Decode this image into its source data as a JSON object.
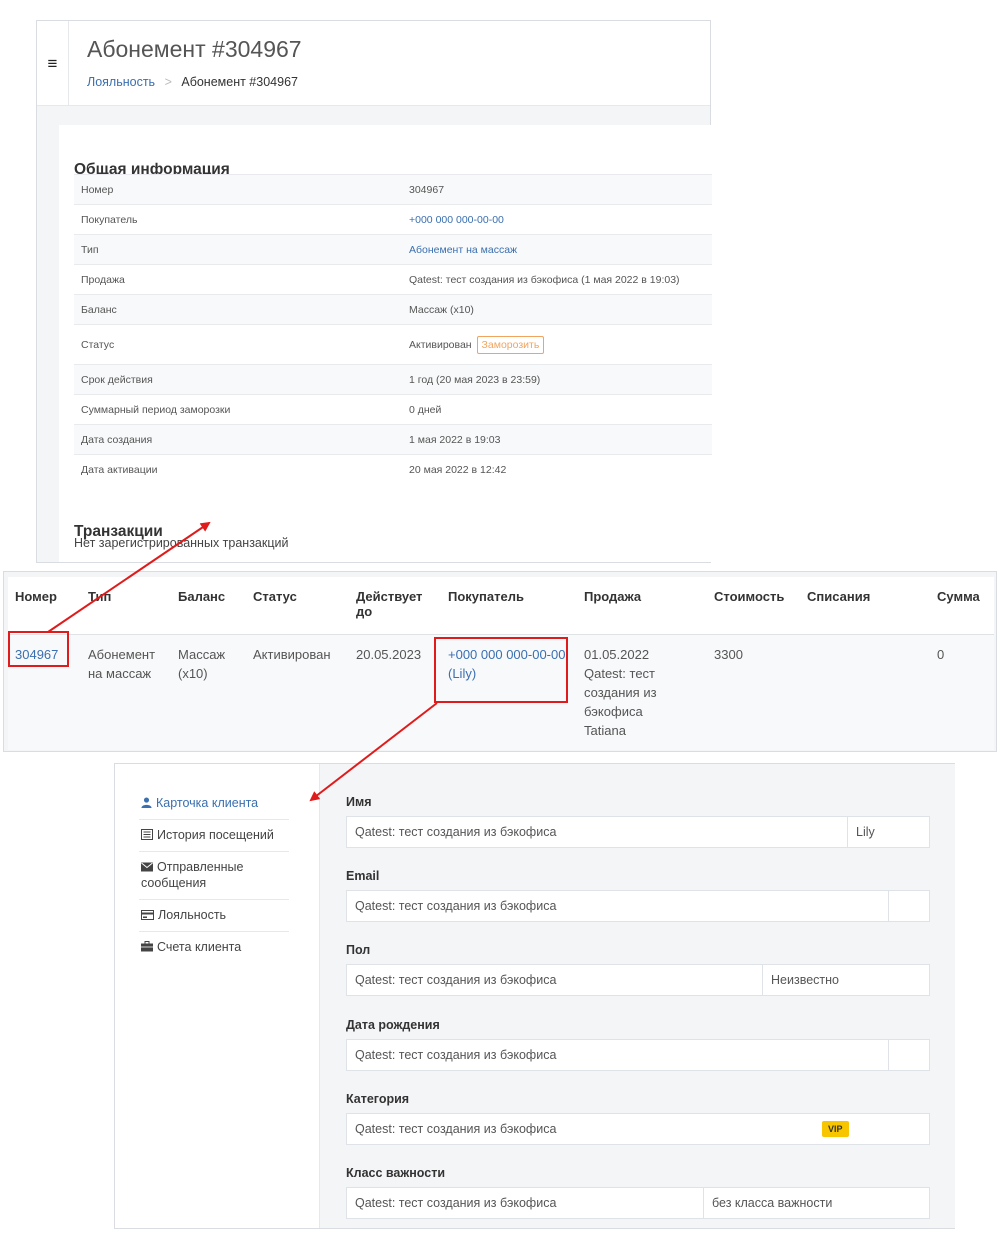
{
  "subscription": {
    "menu_icon": "hamburger-icon",
    "title": "Абонемент #304967",
    "breadcrumb": {
      "parent": "Лояльность",
      "separator": ">",
      "current": "Абонемент #304967"
    },
    "general_title": "Общая информация",
    "rows": [
      {
        "key": "Номер",
        "value": "304967"
      },
      {
        "key": "Покупатель",
        "value": "+000 000 000-00-00"
      },
      {
        "key": "Тип",
        "value": "Абонемент на массаж"
      },
      {
        "key": "Продажа",
        "value": "Qatest: тест создания из бэкофиса (1 мая 2022 в 19:03)"
      },
      {
        "key": "Баланс",
        "value": "Массаж (x10)"
      },
      {
        "key": "Статус",
        "value": "Активирован",
        "button": "Заморозить"
      },
      {
        "key": "Срок действия",
        "value": "1 год (20 мая 2023 в 23:59)"
      },
      {
        "key": "Суммарный период заморозки",
        "value": "0 дней"
      },
      {
        "key": "Дата создания",
        "value": "1 мая 2022 в 19:03"
      },
      {
        "key": "Дата активации",
        "value": "20 мая 2022 в 12:42"
      }
    ],
    "transactions_title": "Транзакции",
    "transactions_empty": "Нет зарегистрированных транзакций"
  },
  "list": {
    "headers": [
      "Номер",
      "Тип",
      "Баланс",
      "Статус",
      "Действует до",
      "Покупатель",
      "Продажа",
      "Стоимость",
      "Списания",
      "Сумма"
    ],
    "row": {
      "number": "304967",
      "type": "Абонемент на массаж",
      "balance": "Массаж (x10)",
      "status": "Активирован",
      "valid_until": "20.05.2023",
      "buyer_phone": "+000 000 000-00-00",
      "buyer_name": "(Lily)",
      "sale_date": "01.05.2022",
      "sale_desc": "Qatest: тест создания из бэкофиса",
      "sale_author": "Tatiana",
      "cost": "3300",
      "writeoffs": "",
      "sum": "0"
    }
  },
  "client": {
    "nav": [
      {
        "label": "Карточка клиента",
        "icon": "user-icon",
        "active": true
      },
      {
        "label": "История посещений",
        "icon": "list-icon",
        "active": false
      },
      {
        "label": "Отправленные сообщения",
        "icon": "envelope-icon",
        "active": false
      },
      {
        "label": "Лояльность",
        "icon": "card-icon",
        "active": false
      },
      {
        "label": "Счета клиента",
        "icon": "briefcase-icon",
        "active": false
      }
    ],
    "fields": [
      {
        "label": "Имя",
        "value": "Qatest: тест создания из бэкофиса",
        "aux": "Lily"
      },
      {
        "label": "Email",
        "value": "Qatest: тест создания из бэкофиса",
        "aux": ""
      },
      {
        "label": "Пол",
        "value": "Qatest: тест создания из бэкофиса",
        "aux": "Неизвестно"
      },
      {
        "label": "Дата рождения",
        "value": "Qatest: тест создания из бэкофиса",
        "aux": ""
      },
      {
        "label": "Категория",
        "value": "Qatest: тест создания из бэкофиса",
        "aux": "VIP"
      },
      {
        "label": "Класс важности",
        "value": "Qatest: тест создания из бэкофиса",
        "aux": "без класса важности"
      }
    ]
  },
  "colors": {
    "link": "#3a6fb0",
    "annotation": "#e01b1b",
    "freeze": "#f0a45e",
    "vip": "#f7c600"
  }
}
